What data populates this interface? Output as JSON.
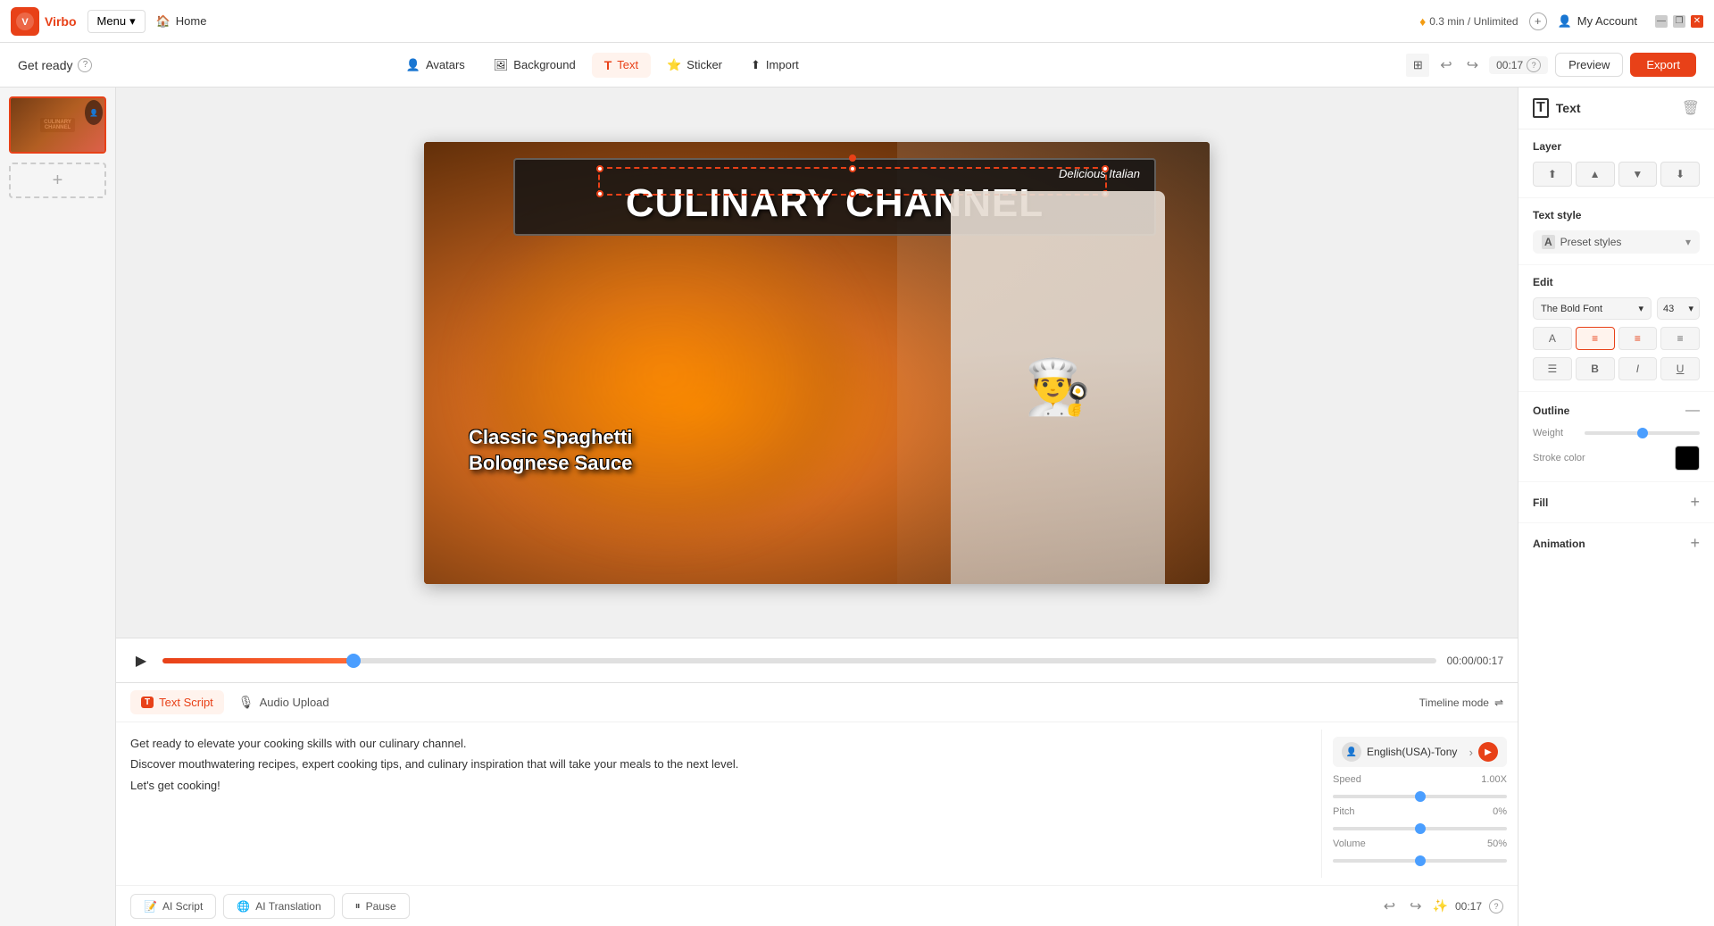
{
  "app": {
    "logo_text": "Virbo",
    "logo_abbr": "V"
  },
  "topbar": {
    "menu_label": "Menu",
    "home_label": "Home",
    "credits": "0.3 min / Unlimited",
    "account_label": "My Account",
    "window_minimize": "—",
    "window_restore": "❐",
    "window_close": "✕"
  },
  "toolbar": {
    "project_name": "Get ready",
    "avatars_label": "Avatars",
    "background_label": "Background",
    "text_label": "Text",
    "sticker_label": "Sticker",
    "import_label": "Import",
    "undo": "↩",
    "redo": "↪",
    "time": "00:17",
    "preview_label": "Preview",
    "export_label": "Export"
  },
  "canvas": {
    "title_subtitle": "Delicious Italian",
    "title_main": "CULINARY CHANNEL",
    "text2_line1": "Classic Spaghetti",
    "text2_line2": "Bolognese Sauce"
  },
  "timeline": {
    "time_current": "00:00",
    "time_total": "00:17"
  },
  "script": {
    "text_script_label": "Text Script",
    "audio_upload_label": "Audio Upload",
    "timeline_mode_label": "Timeline mode",
    "line1": "Get ready to elevate your cooking skills with our culinary channel.",
    "line2": "Discover mouthwatering recipes, expert cooking tips, and culinary inspiration that will take your meals to the next level.",
    "line3": "Let's get cooking!",
    "ai_script_label": "AI Script",
    "ai_translation_label": "AI Translation",
    "pause_label": "Pause",
    "voice_name": "English(USA)-Tony",
    "speed_label": "Speed",
    "speed_value": "1.00X",
    "pitch_label": "Pitch",
    "pitch_value": "0%",
    "volume_label": "Volume",
    "volume_value": "50%",
    "time_bottom": "00:17"
  },
  "right_panel": {
    "title": "Text",
    "layer_label": "Layer",
    "layer_btn1": "⬆",
    "layer_btn2": "▲",
    "layer_btn3": "▼",
    "layer_btn4": "⬇",
    "text_style_label": "Text style",
    "preset_styles_label": "Preset styles",
    "edit_label": "Edit",
    "font_name": "The Bold Font",
    "font_size": "43",
    "outline_label": "Outline",
    "weight_label": "Weight",
    "weight_value": "10",
    "stroke_color_label": "Stroke color",
    "fill_label": "Fill",
    "animation_label": "Animation"
  }
}
